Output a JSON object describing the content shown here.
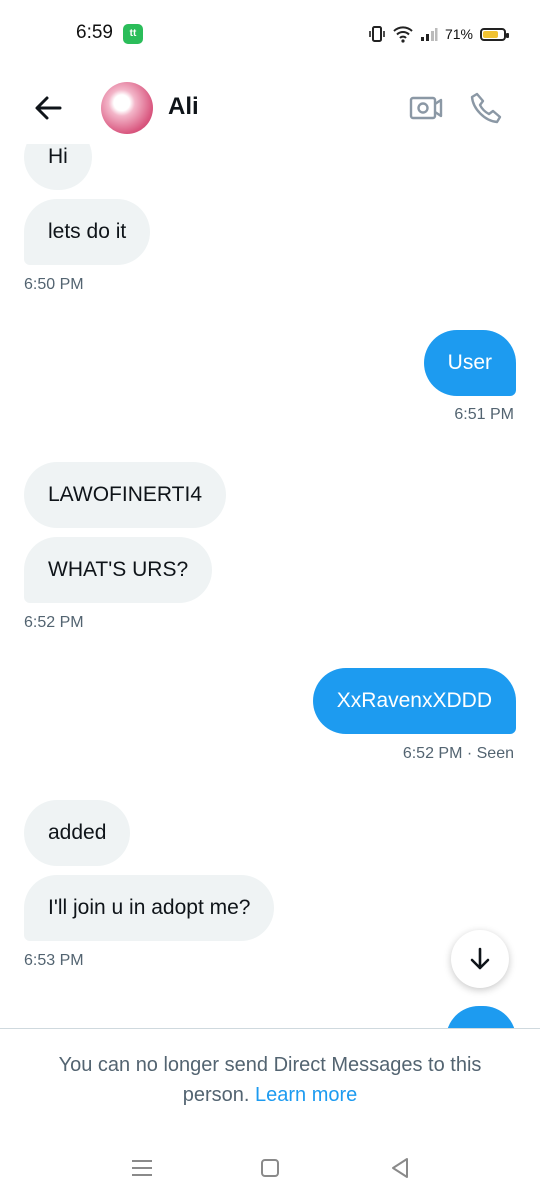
{
  "status_bar": {
    "time": "6:59",
    "app_badge": "tt",
    "battery": "71%"
  },
  "header": {
    "contact_name": "Ali"
  },
  "messages": [
    {
      "side": "in",
      "text": "Hi"
    },
    {
      "side": "in",
      "text": "lets do it"
    },
    {
      "side": "in_time",
      "text": "6:50 PM"
    },
    {
      "side": "out",
      "text": "User"
    },
    {
      "side": "out_time",
      "text": "6:51 PM"
    },
    {
      "side": "in",
      "text": "LAWOFINERTI4"
    },
    {
      "side": "in",
      "text": "WHAT'S URS?"
    },
    {
      "side": "in_time",
      "text": "6:52 PM"
    },
    {
      "side": "out",
      "text": "XxRavenxXDDD"
    },
    {
      "side": "out_time",
      "text": "6:52 PM · Seen"
    },
    {
      "side": "in",
      "text": "added"
    },
    {
      "side": "in",
      "text": "I'll join u in adopt me?"
    },
    {
      "side": "in_time",
      "text": "6:53 PM"
    }
  ],
  "footer": {
    "notice": "You can no longer send Direct Messages to this person.",
    "learn_more": "Learn more"
  },
  "colors": {
    "accent": "#1d9bf0",
    "incoming_bubble": "#eff3f4",
    "muted_text": "#536471"
  },
  "icons": [
    "back-arrow-icon",
    "video-call-icon",
    "phone-icon",
    "scroll-down-arrow-icon",
    "menu-icon",
    "home-square-icon",
    "back-triangle-icon"
  ]
}
